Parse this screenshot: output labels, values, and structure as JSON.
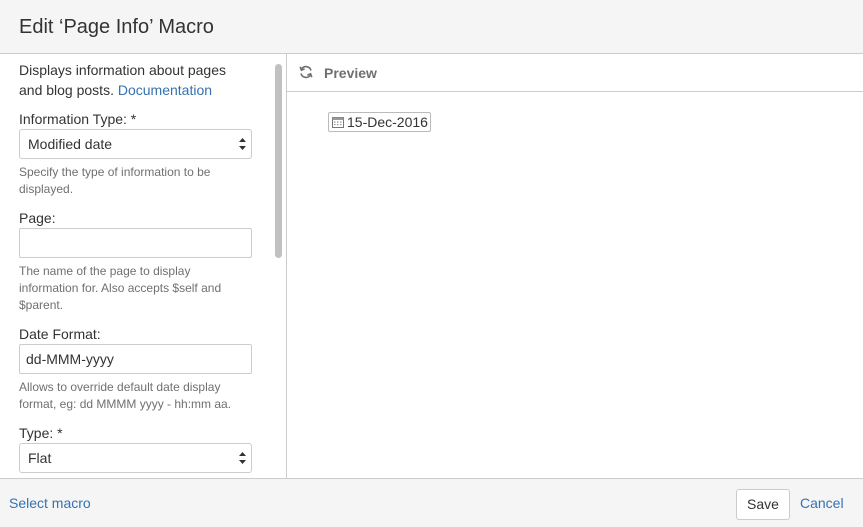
{
  "dialog": {
    "title": "Edit ‘Page Info’ Macro"
  },
  "left": {
    "description": "Displays information about pages and blog posts.",
    "documentation_link": "Documentation",
    "fields": {
      "information_type": {
        "label": "Information Type: *",
        "value": "Modified date",
        "hint": "Specify the type of information to be displayed."
      },
      "page": {
        "label": "Page:",
        "value": "",
        "hint": "The name of the page to display information for. Also accepts $self and $parent."
      },
      "date_format": {
        "label": "Date Format:",
        "value": "dd-MMM-yyyy",
        "hint": "Allows to override default date display format, eg: dd MMMM yyyy - hh:mm aa."
      },
      "type": {
        "label": "Type: *",
        "value": "Flat"
      }
    }
  },
  "preview": {
    "title": "Preview",
    "refresh_icon": "refresh-icon",
    "calendar_icon": "calendar-icon",
    "date_value": "15-Dec-2016"
  },
  "footer": {
    "select_macro": "Select macro",
    "save": "Save",
    "cancel": "Cancel"
  },
  "colors": {
    "link": "#3572b0",
    "border": "#cccccc",
    "chrome_bg": "#f5f5f5",
    "hint_text": "#707070"
  }
}
